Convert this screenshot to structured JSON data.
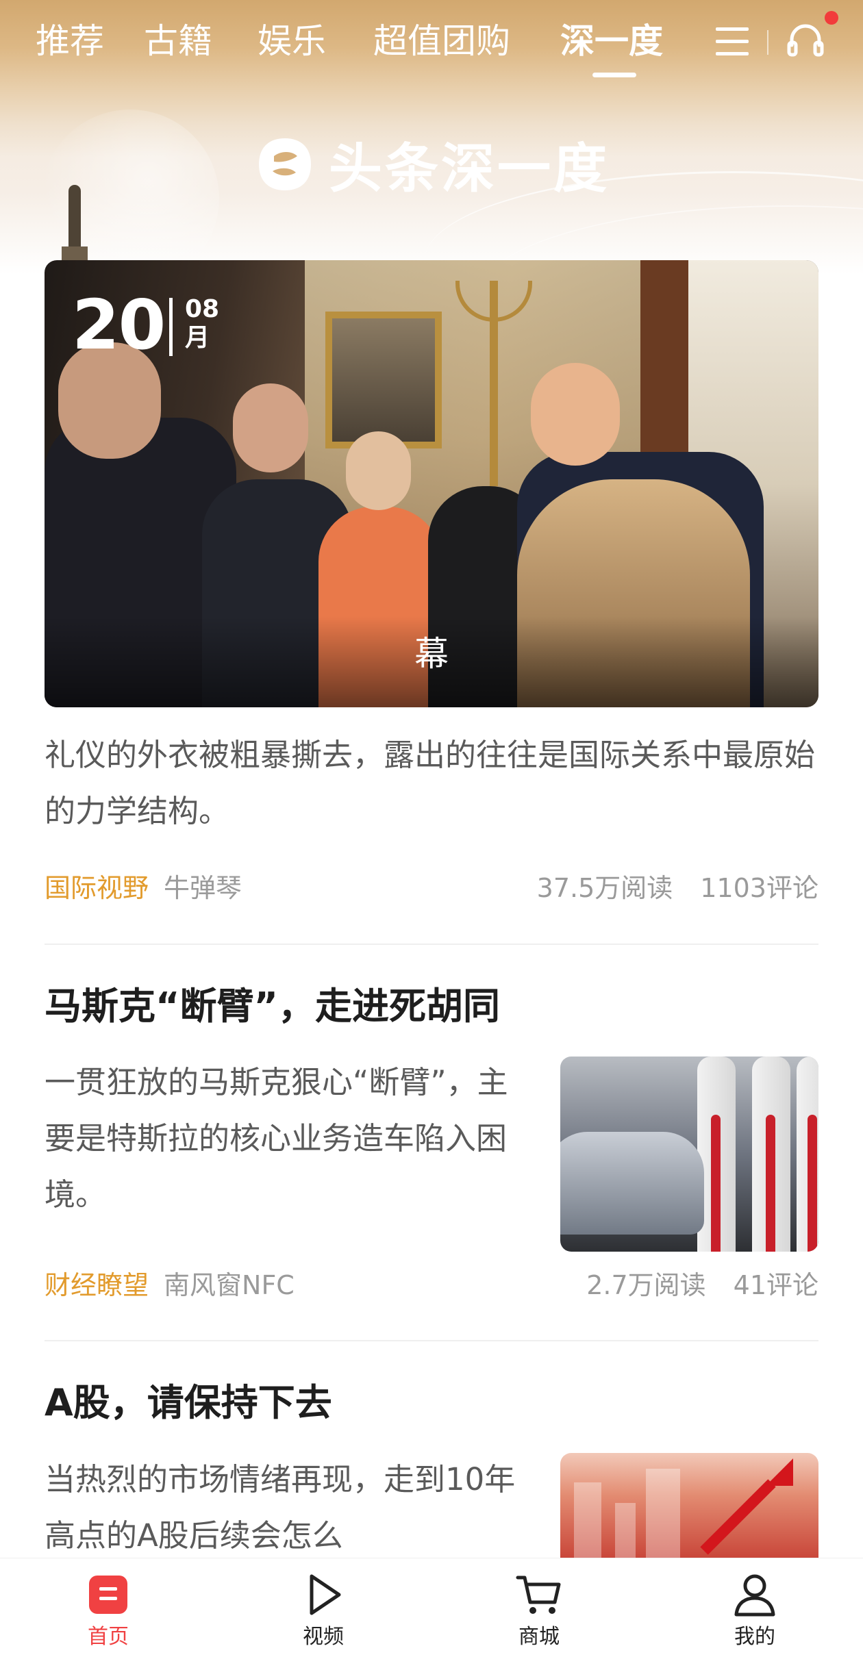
{
  "top_tabs": [
    "推荐",
    "古籍",
    "娱乐",
    "超值团购",
    "深一度"
  ],
  "active_tab_index": 4,
  "icons": {
    "menu": "menu-icon",
    "listen": "headset-icon",
    "notification_dot": "red-dot"
  },
  "brand": {
    "title": "头条深一度"
  },
  "hero": {
    "date_day": "20",
    "date_month_num": "08",
    "date_month_unit": "月",
    "overlay_text": "幕"
  },
  "articles": [
    {
      "excerpt": "礼仪的外衣被粗暴撕去，露出的往往是国际关系中最原始的力学结构。",
      "category": "国际视野",
      "source": "牛弹琴",
      "reads": "37.5万阅读",
      "comments": "1103评论"
    },
    {
      "title": "马斯克“断臂”，走进死胡同",
      "excerpt": "一贯狂放的马斯克狠心“断臂”，主要是特斯拉的核心业务造车陷入困境。",
      "category": "财经瞭望",
      "source": "南风窗NFC",
      "reads": "2.7万阅读",
      "comments": "41评论"
    },
    {
      "title": "A股，请保持下去",
      "excerpt": "当热烈的市场情绪再现，走到10年高点的A股后续会怎么"
    }
  ],
  "bottom_nav": [
    {
      "label": "首页",
      "icon": "home-icon",
      "active": true
    },
    {
      "label": "视频",
      "icon": "video-play-icon",
      "active": false
    },
    {
      "label": "商城",
      "icon": "cart-icon",
      "active": false
    },
    {
      "label": "我的",
      "icon": "profile-icon",
      "active": false
    }
  ],
  "colors": {
    "header_gold": "#d2a86f",
    "category_orange": "#e29b2d",
    "active_red": "#f04142",
    "meta_gray": "#9a9a9a"
  }
}
